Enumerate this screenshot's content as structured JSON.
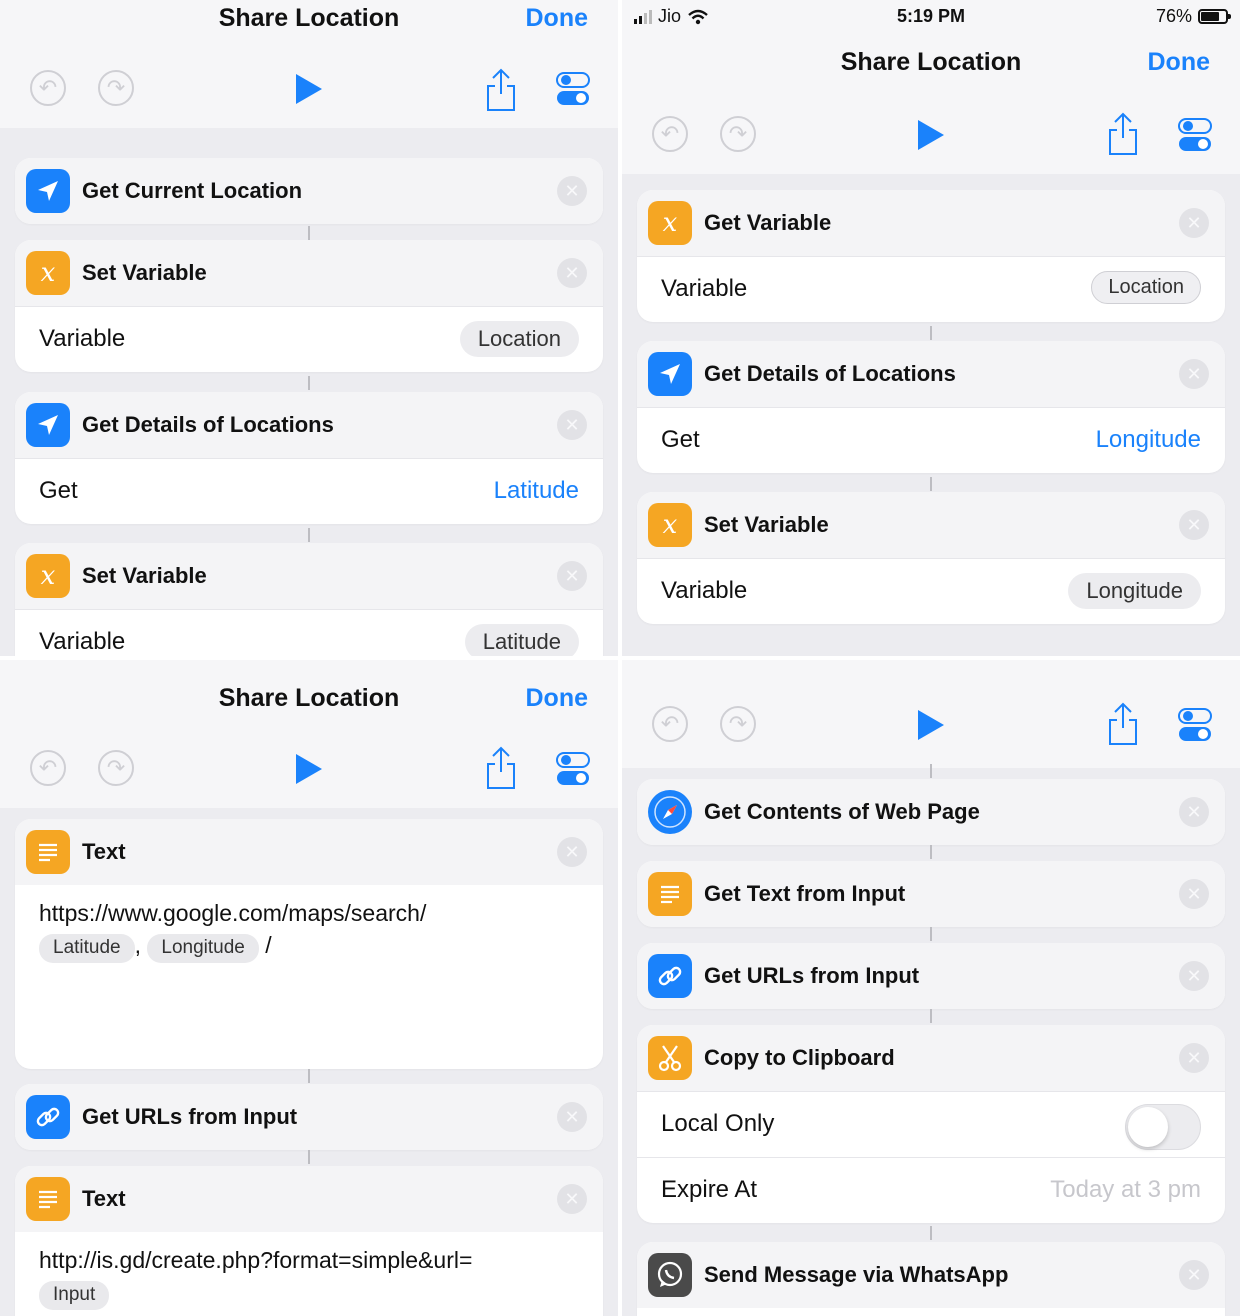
{
  "colors": {
    "accent": "#1a82fb",
    "action_orange": "#f5a623",
    "background": "#ececf0"
  },
  "shortcut": {
    "title": "Share Location",
    "done_label": "Done"
  },
  "status_bar": {
    "carrier": "Jio",
    "time": "5:19 PM",
    "battery": "76%"
  },
  "toolbar": {
    "icons": [
      "undo-icon",
      "redo-icon",
      "play-icon",
      "share-icon",
      "settings-toggle-icon"
    ]
  },
  "panel1": {
    "actions": [
      {
        "title": "Get Current Location",
        "icon": "location-arrow-icon"
      },
      {
        "title": "Set Variable",
        "icon": "variable-x-icon",
        "row_label": "Variable",
        "row_value": "Location"
      },
      {
        "title": "Get Details of Locations",
        "icon": "location-arrow-icon",
        "row_label": "Get",
        "row_value": "Latitude"
      },
      {
        "title": "Set Variable",
        "icon": "variable-x-icon",
        "row_label": "Variable",
        "row_value": "Latitude"
      }
    ]
  },
  "panel2": {
    "actions": [
      {
        "title": "Get Variable",
        "icon": "variable-x-icon",
        "row_label": "Variable",
        "row_value": "Location"
      },
      {
        "title": "Get Details of Locations",
        "icon": "location-arrow-icon",
        "row_label": "Get",
        "row_value": "Longitude"
      },
      {
        "title": "Set Variable",
        "icon": "variable-x-icon",
        "row_label": "Variable",
        "row_value": "Longitude"
      }
    ]
  },
  "panel3": {
    "actions": [
      {
        "title": "Text",
        "icon": "text-lines-icon",
        "text": "https://www.google.com/maps/search/",
        "vars": [
          "Latitude",
          "Longitude"
        ],
        "separator": ",",
        "suffix": "/"
      },
      {
        "title": "Get URLs from Input",
        "icon": "link-icon"
      },
      {
        "title": "Text",
        "icon": "text-lines-icon",
        "text": "http://is.gd/create.php?format=simple&url=",
        "vars": [
          "Input"
        ]
      }
    ]
  },
  "panel4": {
    "actions": [
      {
        "title": "Get Contents of Web Page",
        "icon": "safari-compass-icon"
      },
      {
        "title": "Get Text from Input",
        "icon": "text-lines-icon"
      },
      {
        "title": "Get URLs from Input",
        "icon": "link-icon"
      },
      {
        "title": "Copy to Clipboard",
        "icon": "scissors-icon",
        "rows": [
          {
            "label": "Local Only",
            "toggle": false
          },
          {
            "label": "Expire At",
            "value": "Today at 3 pm"
          }
        ]
      },
      {
        "title": "Send Message via WhatsApp",
        "icon": "whatsapp-icon"
      }
    ]
  }
}
